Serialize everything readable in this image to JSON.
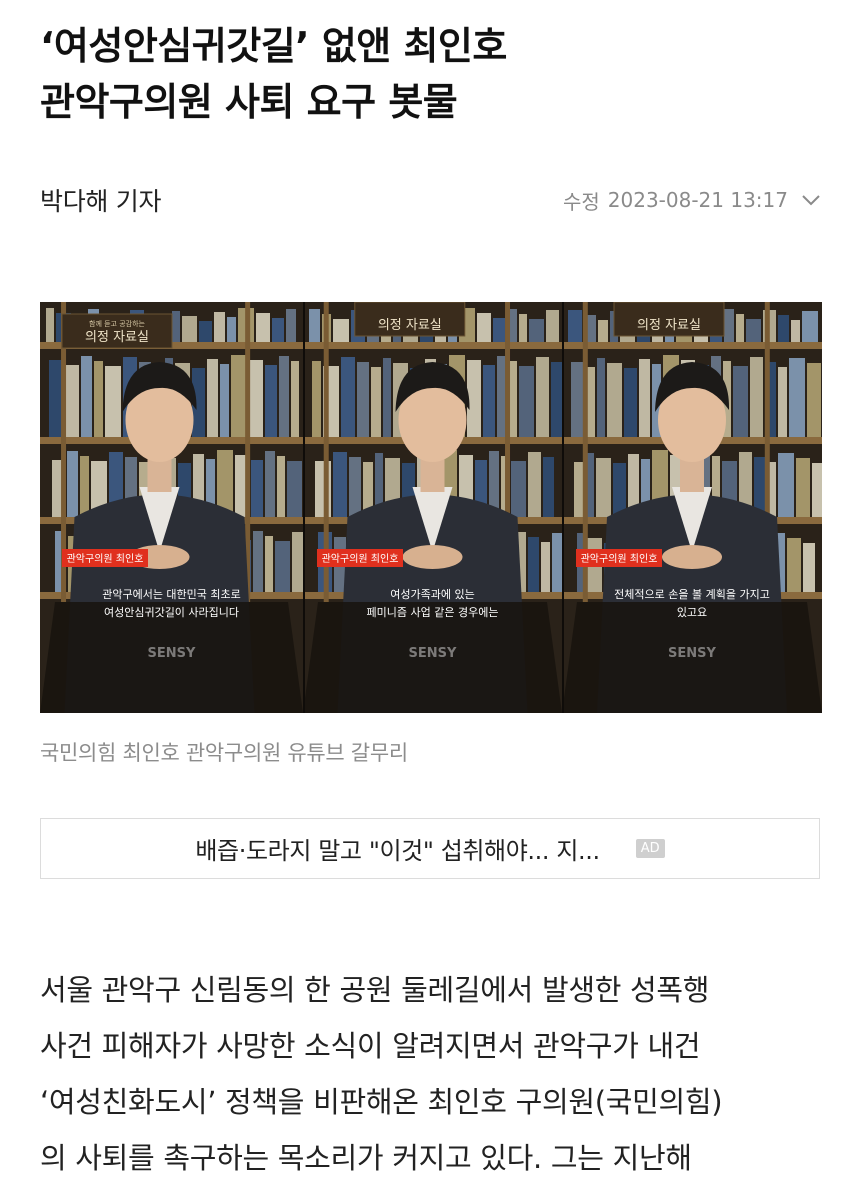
{
  "headline": {
    "line1": "‘여성안심귀갓길’ 없앤 최인호",
    "line2": "관악구의원 사퇴 요구 봇물"
  },
  "byline": {
    "reporter": "박다해 기자",
    "modified_label": "수정",
    "timestamp": "2023-08-21 13:17"
  },
  "photo": {
    "panels": [
      {
        "sign": "의정 자료실",
        "sign_small": "함께 듣고 공감하는",
        "name_tag": "관악구의원 최인호",
        "subtitle_line1": "관악구에서는 대한민국 최초로",
        "subtitle_line2": "여성안심귀갓길이 사라집니다",
        "watermark": "SENSY"
      },
      {
        "sign": "의정 자료실",
        "sign_small": "",
        "name_tag": "관악구의원 최인호",
        "subtitle_line1": "여성가족과에 있는",
        "subtitle_line2": "페미니즘 사업 같은 경우에는",
        "watermark": "SENSY"
      },
      {
        "sign": "의정 자료실",
        "sign_small": "",
        "name_tag": "관악구의원 최인호",
        "subtitle_line1": "전체적으로 손을 볼 계획을 가지고",
        "subtitle_line2": "있고요",
        "watermark": "SENSY"
      }
    ],
    "caption": "국민의힘 최인호 관악구의원 유튜브 갈무리"
  },
  "ad": {
    "text": "배즙·도라지 말고 \"이것\" 섭취해야... 지...",
    "badge": "AD"
  },
  "article": {
    "lines": [
      "서울 관악구 신림동의 한 공원 둘레길에서 발생한 성폭행",
      "사건 피해자가 사망한 소식이 알려지면서 관악구가 내건",
      "‘여성친화도시’ 정책을 비판해온 최인호 구의원(국민의힘)",
      "의 사퇴를 촉구하는 목소리가 커지고 있다. 그는 지난해"
    ]
  },
  "colors": {
    "name_tag_bg": "#e0301e",
    "text_primary": "#111111",
    "text_muted": "#8a8a8a"
  }
}
